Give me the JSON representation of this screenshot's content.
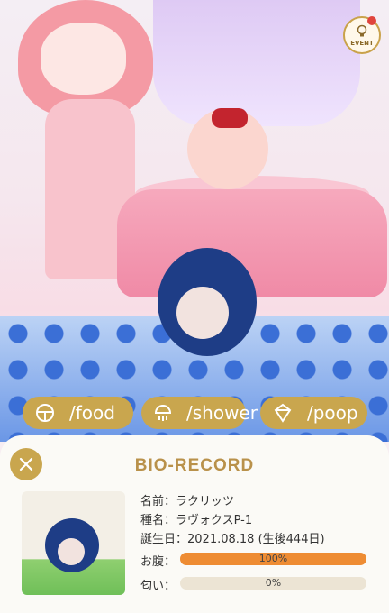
{
  "scene": {
    "event_label": "EVENT"
  },
  "actions": [
    {
      "label": "/food",
      "icon": "food-bowl-icon"
    },
    {
      "label": "/shower",
      "icon": "shower-icon"
    },
    {
      "label": "/poop",
      "icon": "poop-icon"
    }
  ],
  "panel": {
    "title": "BIO-RECORD",
    "close_icon": "close-icon",
    "name_label": "名前：",
    "name_value": "ラクリッツ",
    "species_label": "種名：",
    "species_value": "ラヴォクスP-1",
    "birthday_label": "誕生日：",
    "birthday_value": "2021.08.18 (生後444日)",
    "hunger_label": "お腹：",
    "hunger_text": "100%",
    "hunger_value": 1.0,
    "smell_label": "匂い：",
    "smell_text": "0%",
    "smell_value": 0.0
  },
  "colors": {
    "accent_gold": "#c9a64e",
    "title_gold": "#b9914a",
    "bar_fill": "#ee8c33",
    "bar_track": "#ece4d4"
  }
}
